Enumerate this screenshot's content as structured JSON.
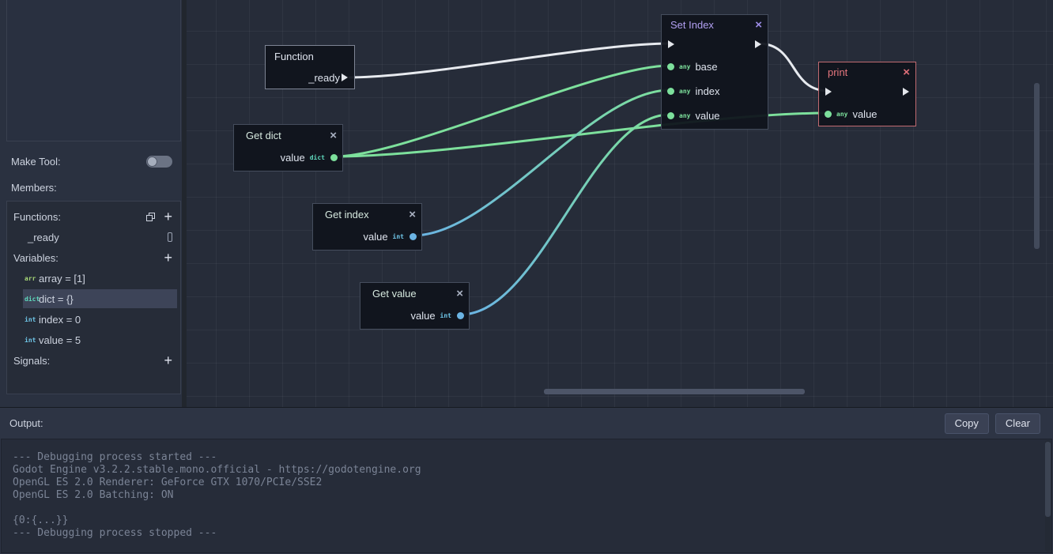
{
  "icons": {
    "close": "×",
    "plus": "+"
  },
  "colors": {
    "sequence_wire": "#e7eaef",
    "dict_wire": "#7de09c",
    "int_wire": "#6bb4e4",
    "set_index_accent": "#b2a0f2",
    "print_accent": "#e5767e",
    "port_green": "#7de09c",
    "port_blue": "#6bb4e4"
  },
  "sidebar": {
    "make_tool_label": "Make Tool:",
    "members_label": "Members:",
    "functions_label": "Functions:",
    "functions": [
      {
        "name": "_ready"
      }
    ],
    "variables_label": "Variables:",
    "variables": [
      {
        "type": "arr",
        "text": "array = [1]"
      },
      {
        "type": "dict",
        "text": "dict = {}"
      },
      {
        "type": "int",
        "text": "index = 0"
      },
      {
        "type": "int",
        "text": "value = 5"
      }
    ],
    "signals_label": "Signals:"
  },
  "graph": {
    "nodes": {
      "function": {
        "title": "Function",
        "output": "_ready"
      },
      "set_index": {
        "title": "Set Index",
        "inputs": [
          {
            "type": "any",
            "name": "base"
          },
          {
            "type": "any",
            "name": "index"
          },
          {
            "type": "any",
            "name": "value"
          }
        ]
      },
      "print": {
        "title": "print",
        "inputs": [
          {
            "type": "any",
            "name": "value"
          }
        ]
      },
      "get_dict": {
        "title": "Get dict",
        "output": {
          "name": "value",
          "type": "dict"
        }
      },
      "get_index": {
        "title": "Get index",
        "output": {
          "name": "value",
          "type": "int"
        }
      },
      "get_value": {
        "title": "Get value",
        "output": {
          "name": "value",
          "type": "int"
        }
      }
    }
  },
  "output": {
    "label": "Output:",
    "copy_label": "Copy",
    "clear_label": "Clear",
    "lines": [
      "--- Debugging process started ---",
      "Godot Engine v3.2.2.stable.mono.official - https://godotengine.org",
      "OpenGL ES 2.0 Renderer: GeForce GTX 1070/PCIe/SSE2",
      "OpenGL ES 2.0 Batching: ON",
      "",
      "{0:{...}}",
      "--- Debugging process stopped ---"
    ]
  }
}
